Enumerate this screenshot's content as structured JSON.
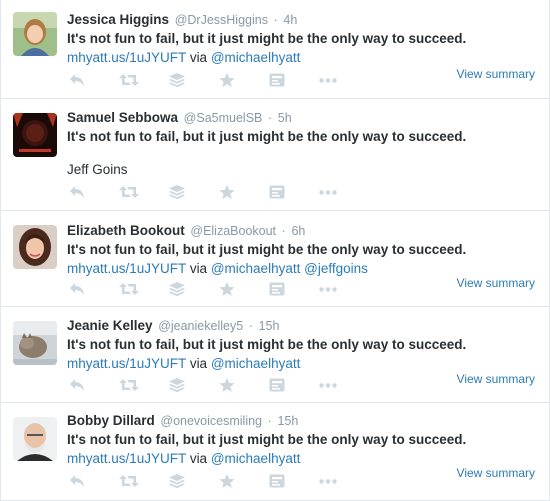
{
  "tweets": [
    {
      "name": "Jessica Higgins",
      "handle": "@DrJessHiggins",
      "sep": "·",
      "time": "4h",
      "text": "It's not fun to fail, but it just might be the only way to succeed.",
      "link": "mhyatt.us/1uJYUFT",
      "via": "via",
      "mention": "@michaelhyatt",
      "summary": "View summary"
    },
    {
      "name": "Samuel Sebbowa",
      "handle": "@Sa5muelSB",
      "sep": "·",
      "time": "5h",
      "text": "It's not fun to fail, but it just might be the only way to succeed.",
      "extra": "Jeff Goins"
    },
    {
      "name": "Elizabeth Bookout",
      "handle": "@ElizaBookout",
      "sep": "·",
      "time": "6h",
      "text": "It's not fun to fail, but it just might be the only way to succeed.",
      "link": "mhyatt.us/1uJYUFT",
      "via": "via",
      "mention": "@michaelhyatt",
      "mention2": "@jeffgoins",
      "summary": "View summary"
    },
    {
      "name": "Jeanie Kelley",
      "handle": "@jeaniekelley5",
      "sep": "·",
      "time": "15h",
      "text": "It's not fun to fail, but it just might be the only way to succeed.",
      "link": "mhyatt.us/1uJYUFT",
      "via": "via",
      "mention": "@michaelhyatt",
      "summary": "View summary"
    },
    {
      "name": "Bobby Dillard",
      "handle": "@onevoicesmiling",
      "sep": "·",
      "time": "15h",
      "text": "It's not fun to fail, but it just might be the only way to succeed.",
      "link": "mhyatt.us/1uJYUFT",
      "via": "via",
      "mention": "@michaelhyatt",
      "summary": "View summary"
    }
  ],
  "icons": [
    "reply-icon",
    "retweet-icon",
    "buffer-icon",
    "favorite-icon",
    "summary-card-icon",
    "more-icon"
  ],
  "colors": {
    "link": "#2b7bb9",
    "meta": "#8899a6",
    "icon": "#ccd6dd",
    "border": "#e1e8ed"
  }
}
